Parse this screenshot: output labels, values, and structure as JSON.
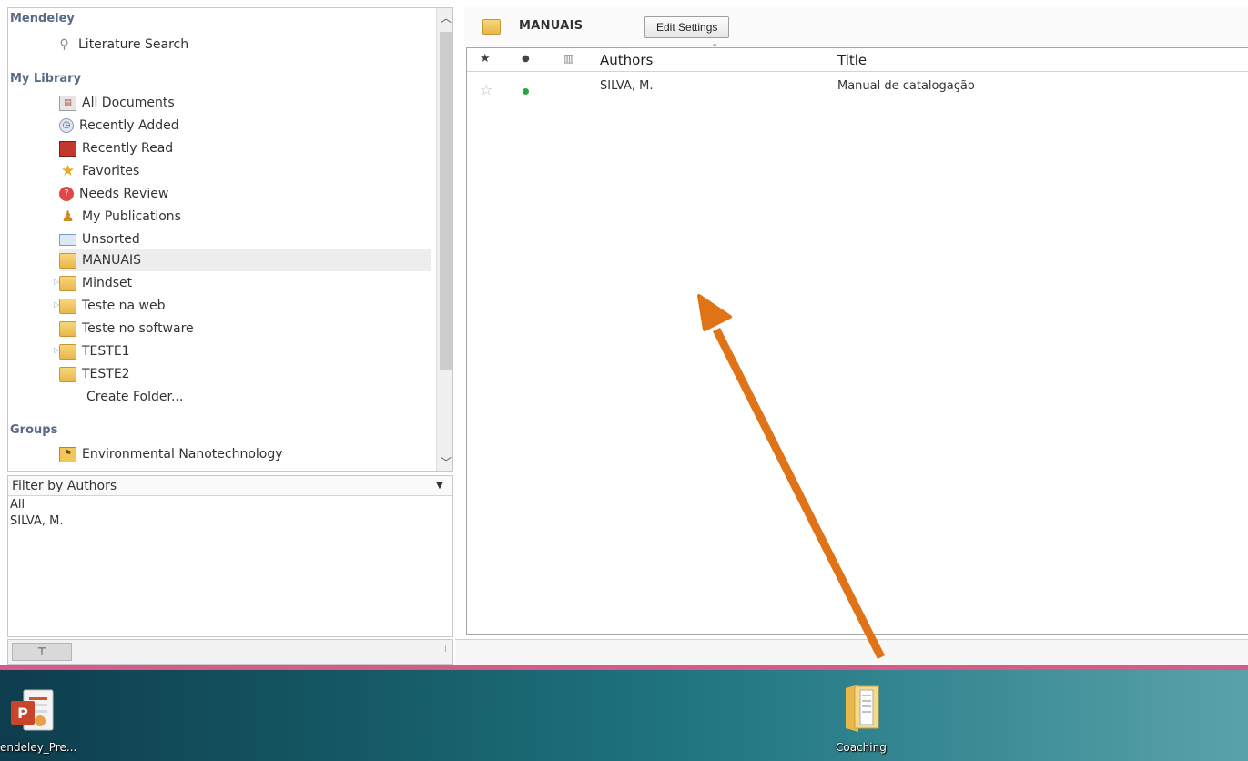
{
  "sidebar": {
    "sections": {
      "mendeley": "Mendeley",
      "my_library": "My Library",
      "groups": "Groups"
    },
    "literature_search": "Literature Search",
    "library_items": [
      {
        "label": "All Documents",
        "icon": "documents-icon"
      },
      {
        "label": "Recently Added",
        "icon": "clock-icon"
      },
      {
        "label": "Recently Read",
        "icon": "book-icon"
      },
      {
        "label": "Favorites",
        "icon": "star-icon"
      },
      {
        "label": "Needs Review",
        "icon": "review-icon"
      },
      {
        "label": "My Publications",
        "icon": "person-icon"
      },
      {
        "label": "Unsorted",
        "icon": "unsorted-icon"
      }
    ],
    "folders": [
      {
        "label": "MANUAIS",
        "selected": true,
        "expandable": false
      },
      {
        "label": "Mindset",
        "selected": false,
        "expandable": true
      },
      {
        "label": "Teste na web",
        "selected": false,
        "expandable": true
      },
      {
        "label": "Teste no software",
        "selected": false,
        "expandable": false
      },
      {
        "label": "TESTE1",
        "selected": false,
        "expandable": true
      },
      {
        "label": "TESTE2",
        "selected": false,
        "expandable": false
      }
    ],
    "create_folder": "Create Folder...",
    "group_items": [
      {
        "label": "Environmental Nanotechnology",
        "icon": "group-icon"
      }
    ]
  },
  "filter": {
    "label": "Filter by Authors",
    "values": [
      "All",
      "SILVA, M."
    ]
  },
  "main": {
    "folder_title": "MANUAIS",
    "edit_settings": "Edit Settings",
    "columns": {
      "star": "★",
      "read": "●",
      "attachment": "▥",
      "authors": "Authors",
      "title": "Title"
    },
    "rows": [
      {
        "authors": "SILVA, M.",
        "title": "Manual de catalogação",
        "favorite": false,
        "unread": true
      }
    ]
  },
  "desktop": {
    "icons": [
      {
        "label": "endeley_Pre...",
        "icon": "powerpoint-icon"
      },
      {
        "label": "Coaching",
        "icon": "folder-icon"
      }
    ]
  },
  "colors": {
    "accent_arrow": "#e07318",
    "unread_dot": "#2aa53c",
    "taskbar_border": "#d85a88"
  }
}
